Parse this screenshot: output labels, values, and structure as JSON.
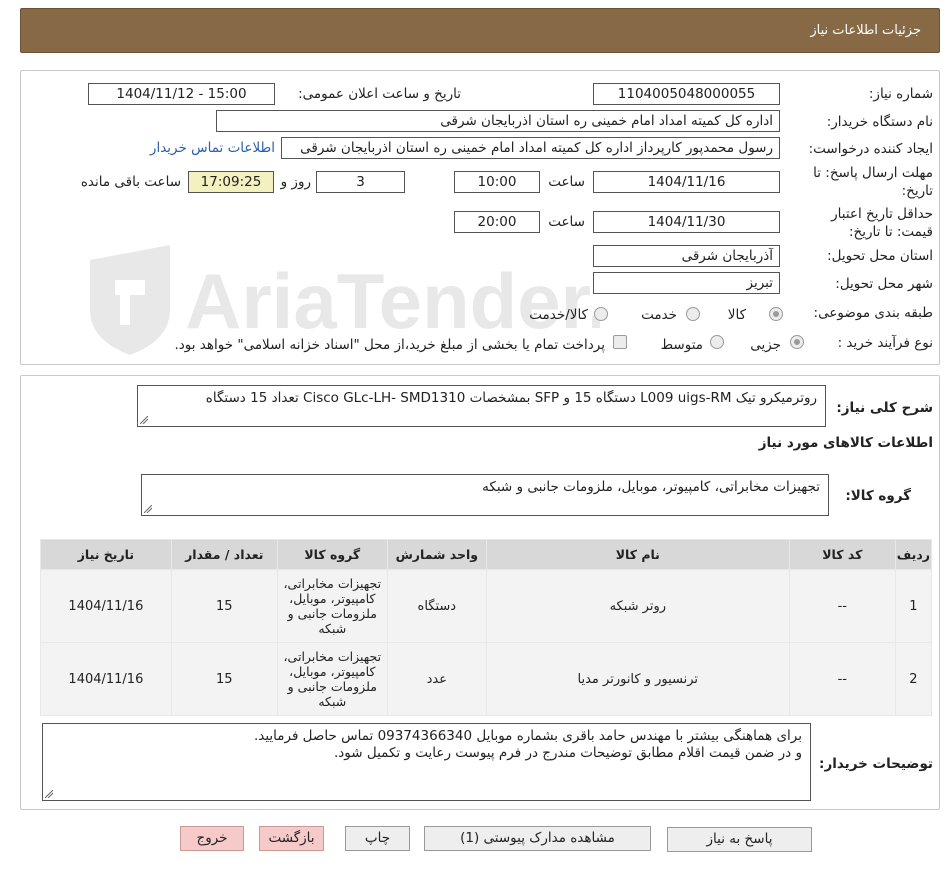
{
  "header": {
    "title": "جزئیات اطلاعات نیاز"
  },
  "watermark": {
    "text": "AriaTender.neT"
  },
  "form": {
    "need_number_label": "شماره نیاز:",
    "need_number": "1104005048000055",
    "announce_label": "تاریخ و ساعت اعلان عمومی:",
    "announce_value": "1404/11/12 - 15:00",
    "buyer_org_label": "نام دستگاه خریدار:",
    "buyer_org": "اداره کل کمیته امداد امام خمینی  ره  استان اذربایجان شرقی",
    "creator_label": "ایجاد کننده درخواست:",
    "creator": "رسول محمدپور کارپرداز اداره کل کمیته امداد امام خمینی  ره  استان اذربایجان شرقی",
    "contact_link": "اطلاعات تماس خریدار",
    "send_deadline_label_1": "مهلت ارسال پاسخ: تا",
    "send_deadline_label_2": "تاریخ:",
    "send_date": "1404/11/16",
    "time_label": "ساعت",
    "send_time": "10:00",
    "days_value": "3",
    "days_label": "روز و",
    "remaining_time": "17:09:25",
    "remaining_label": "ساعت باقی مانده",
    "price_valid_label_1": "حداقل تاریخ اعتبار",
    "price_valid_label_2": "قیمت: تا تاریخ:",
    "price_valid_date": "1404/11/30",
    "price_valid_time": "20:00",
    "province_label": "استان محل تحویل:",
    "province": "آذربایجان شرقی",
    "city_label": "شهر محل تحویل:",
    "city": "تبریز",
    "category_label": "طبقه بندی موضوعی:",
    "category_options": [
      "کالا",
      "خدمت",
      "کالا/خدمت"
    ],
    "category_selected": "کالا",
    "process_label": "نوع فرآیند خرید :",
    "process_options": [
      "جزیی",
      "متوسط"
    ],
    "treasury_note": "پرداخت تمام یا بخشی از مبلغ خرید،از محل \"اسناد خزانه اسلامی\" خواهد بود."
  },
  "summary": {
    "label": "شرح کلی نیاز:",
    "text": "روترمیکرو تیک L009 uigs-RM دستگاه 15 و SFP بمشخصات Cisco GLc-LH- SMD1310 تعداد 15 دستگاه",
    "goods_info_title": "اطلاعات کالاهای مورد نیاز",
    "goods_group_label": "گروه کالا:",
    "goods_group": "تجهیزات مخابراتی، کامپیوتر، موبایل، ملزومات جانبی و شبکه"
  },
  "table": {
    "headers": [
      "ردیف",
      "کد کالا",
      "نام کالا",
      "واحد شمارش",
      "گروه کالا",
      "تعداد / مقدار",
      "تاریخ نیاز"
    ],
    "rows": [
      [
        "1",
        "--",
        "روتر شبکه",
        "دستگاه",
        "تجهیزات مخابراتی، کامپیوتر، موبایل، ملزومات جانبی و شبکه",
        "15",
        "1404/11/16"
      ],
      [
        "2",
        "--",
        "ترنسیور و کانورتر مدیا",
        "عدد",
        "تجهیزات مخابراتی، کامپیوتر، موبایل، ملزومات جانبی و شبکه",
        "15",
        "1404/11/16"
      ]
    ]
  },
  "buyer_notes": {
    "label": "توضیحات خریدار:",
    "line1": "برای هماهنگی بیشتر با مهندس حامد باقری بشماره موبایل 09374366340 تماس حاصل فرمایید.",
    "line2": "و در ضمن قیمت اقلام مطابق توضیحات مندرج  در فرم پیوست رعایت و تکمیل شود."
  },
  "buttons": {
    "reply": "پاسخ به نیاز",
    "attachments": "مشاهده مدارک پیوستی (1)",
    "print": "چاپ",
    "back": "بازگشت",
    "exit": "خروج"
  }
}
